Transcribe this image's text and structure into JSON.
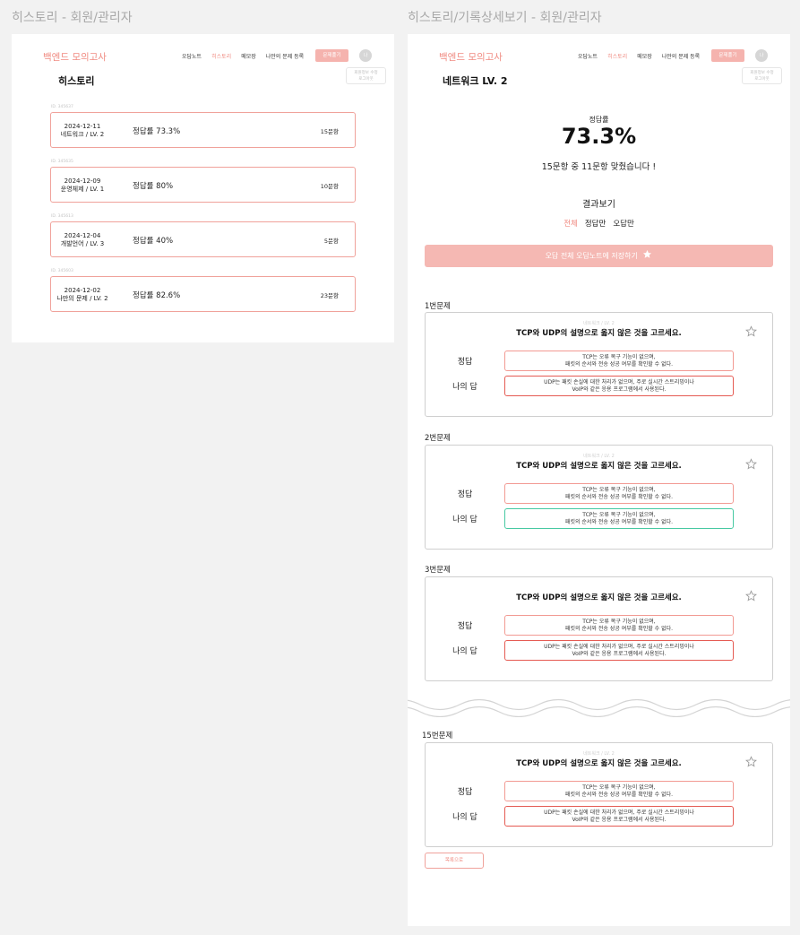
{
  "frames": {
    "history_label": "히스토리  - 회원/관리자",
    "detail_label": "히스토리/기록상세보기 - 회원/관리자"
  },
  "header": {
    "logo": "백엔드 모의고사",
    "nav": [
      "오답노트",
      "히스토리",
      "메모장",
      "나만의 문제 등록"
    ],
    "active_nav": "히스토리",
    "solve_button": "문제풀기",
    "avatar": "나",
    "user_popup_line1": "회원정보 수정",
    "user_popup_line2": "로그아웃",
    "accent_color": "#f08b82"
  },
  "history": {
    "title": "히스토리",
    "items": [
      {
        "id": "ID. 345637",
        "date": "2024-12-11",
        "category": "네트워크 / LV. 2",
        "rate": "정답률 73.3%",
        "count": "15문항"
      },
      {
        "id": "ID. 345635",
        "date": "2024-12-09",
        "category": "운영체제 / LV. 1",
        "rate": "정답률 80%",
        "count": "10문항"
      },
      {
        "id": "ID. 345613",
        "date": "2024-12-04",
        "category": "개발언어 / LV. 3",
        "rate": "정답률 40%",
        "count": "5문항"
      },
      {
        "id": "ID. 345603",
        "date": "2024-12-02",
        "category": "나만의 문제 / LV. 2",
        "rate": "정답률 82.6%",
        "count": "23문항"
      }
    ]
  },
  "detail": {
    "title": "네트워크 LV. 2",
    "rate_label": "정답률",
    "rate_value": "73.3%",
    "summary": "15문항 중 11문항 맞췄습니다 !",
    "result_heading": "결과보기",
    "filters": [
      "전체",
      "정답만",
      "오답만"
    ],
    "active_filter": "전체",
    "save_wrong_button": "오답 전체 오답노트에 저장하기",
    "answer_label": "정답",
    "my_answer_label": "나의 답",
    "back_button": "목록으로",
    "questions": [
      {
        "label": "1번문제",
        "level": "네트워크 / LV. 2",
        "text": "TCP와 UDP의 설명으로 옳지 않은 것을 고르세요.",
        "answer_line1": "TCP는 오류 복구 기능이 없으며,",
        "answer_line2": "패킷의 순서와 전송 성공 여부를 확인할 수 없다.",
        "mine_line1": "UDP는 패킷 손실에 대한 처리가 없으며, 주로 실시간 스트리밍이나",
        "mine_line2": "VoIP와 같은 응용 프로그램에서 사용된다.",
        "correct": false
      },
      {
        "label": "2번문제",
        "level": "네트워크 / LV. 2",
        "text": "TCP와 UDP의 설명으로 옳지 않은 것을 고르세요.",
        "answer_line1": "TCP는 오류 복구 기능이 없으며,",
        "answer_line2": "패킷의 순서와 전송 성공 여부를 확인할 수 없다.",
        "mine_line1": "TCP는 오류 복구 기능이 없으며,",
        "mine_line2": "패킷의 순서와 전송 성공 여부를 확인할 수 없다.",
        "correct": true
      },
      {
        "label": "3번문제",
        "level": "",
        "text": "TCP와 UDP의 설명으로 옳지 않은 것을 고르세요.",
        "answer_line1": "TCP는 오류 복구 기능이 없으며,",
        "answer_line2": "패킷의 순서와 전송 성공 여부를 확인할 수 없다.",
        "mine_line1": "UDP는 패킷 손실에 대한 처리가 없으며, 주로 실시간 스트리밍이나",
        "mine_line2": "VoIP와 같은 응용 프로그램에서 사용된다.",
        "correct": false
      },
      {
        "label": "15번문제",
        "level": "네트워크 / LV. 2",
        "text": "TCP와 UDP의 설명으로 옳지 않은 것을 고르세요.",
        "answer_line1": "TCP는 오류 복구 기능이 없으며,",
        "answer_line2": "패킷의 순서와 전송 성공 여부를 확인할 수 없다.",
        "mine_line1": "UDP는 패킷 손실에 대한 처리가 없으며, 주로 실시간 스트리밍이나",
        "mine_line2": "VoIP와 같은 응용 프로그램에서 사용된다.",
        "correct": false
      }
    ]
  }
}
